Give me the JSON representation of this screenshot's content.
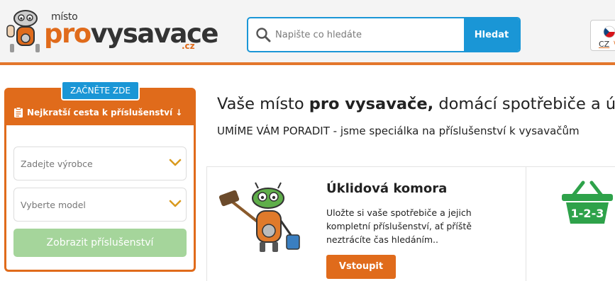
{
  "header": {
    "logo": {
      "small_text": "místo",
      "pro_text": "pro",
      "main_text": "vysavace",
      "tld_text": ".cz"
    },
    "search": {
      "placeholder": "Napište co hledáte",
      "button_label": "Hledat"
    },
    "language": {
      "label": "CZ",
      "flag_icon": "czech-flag-icon",
      "chevron_icon": "chevron-down-icon"
    },
    "accent_color": "#e06b1b",
    "brand_blue": "#1a96d6"
  },
  "side_panel": {
    "badge": "ZAČNĚTE ZDE",
    "title": "Nejkratší cesta k příslušenství ↓",
    "title_icon": "clipboard-icon",
    "manufacturer_select": "Zadejte výrobce",
    "model_select": "Vyberte model",
    "submit_label": "Zobrazit příslušenství",
    "submit_color": "#a5d59b"
  },
  "main": {
    "headline_prefix": "Vaše místo ",
    "headline_bold": "pro vysavače,",
    "headline_suffix": " domácí spotřebiče a úklid",
    "subline": "UMÍME VÁM PORADIT - jsme speciálka na příslušenství k vysavačům",
    "card": {
      "title": "Úklidová komora",
      "text": "Uložte si vaše spotřebiče a jejich kompletní příslušenství, ať příště neztrácíte čas hledáním..",
      "button_label": "Vstoupit",
      "mascot_icon": "cleaning-robot-mascot",
      "basket_label": "1-2-3"
    }
  }
}
